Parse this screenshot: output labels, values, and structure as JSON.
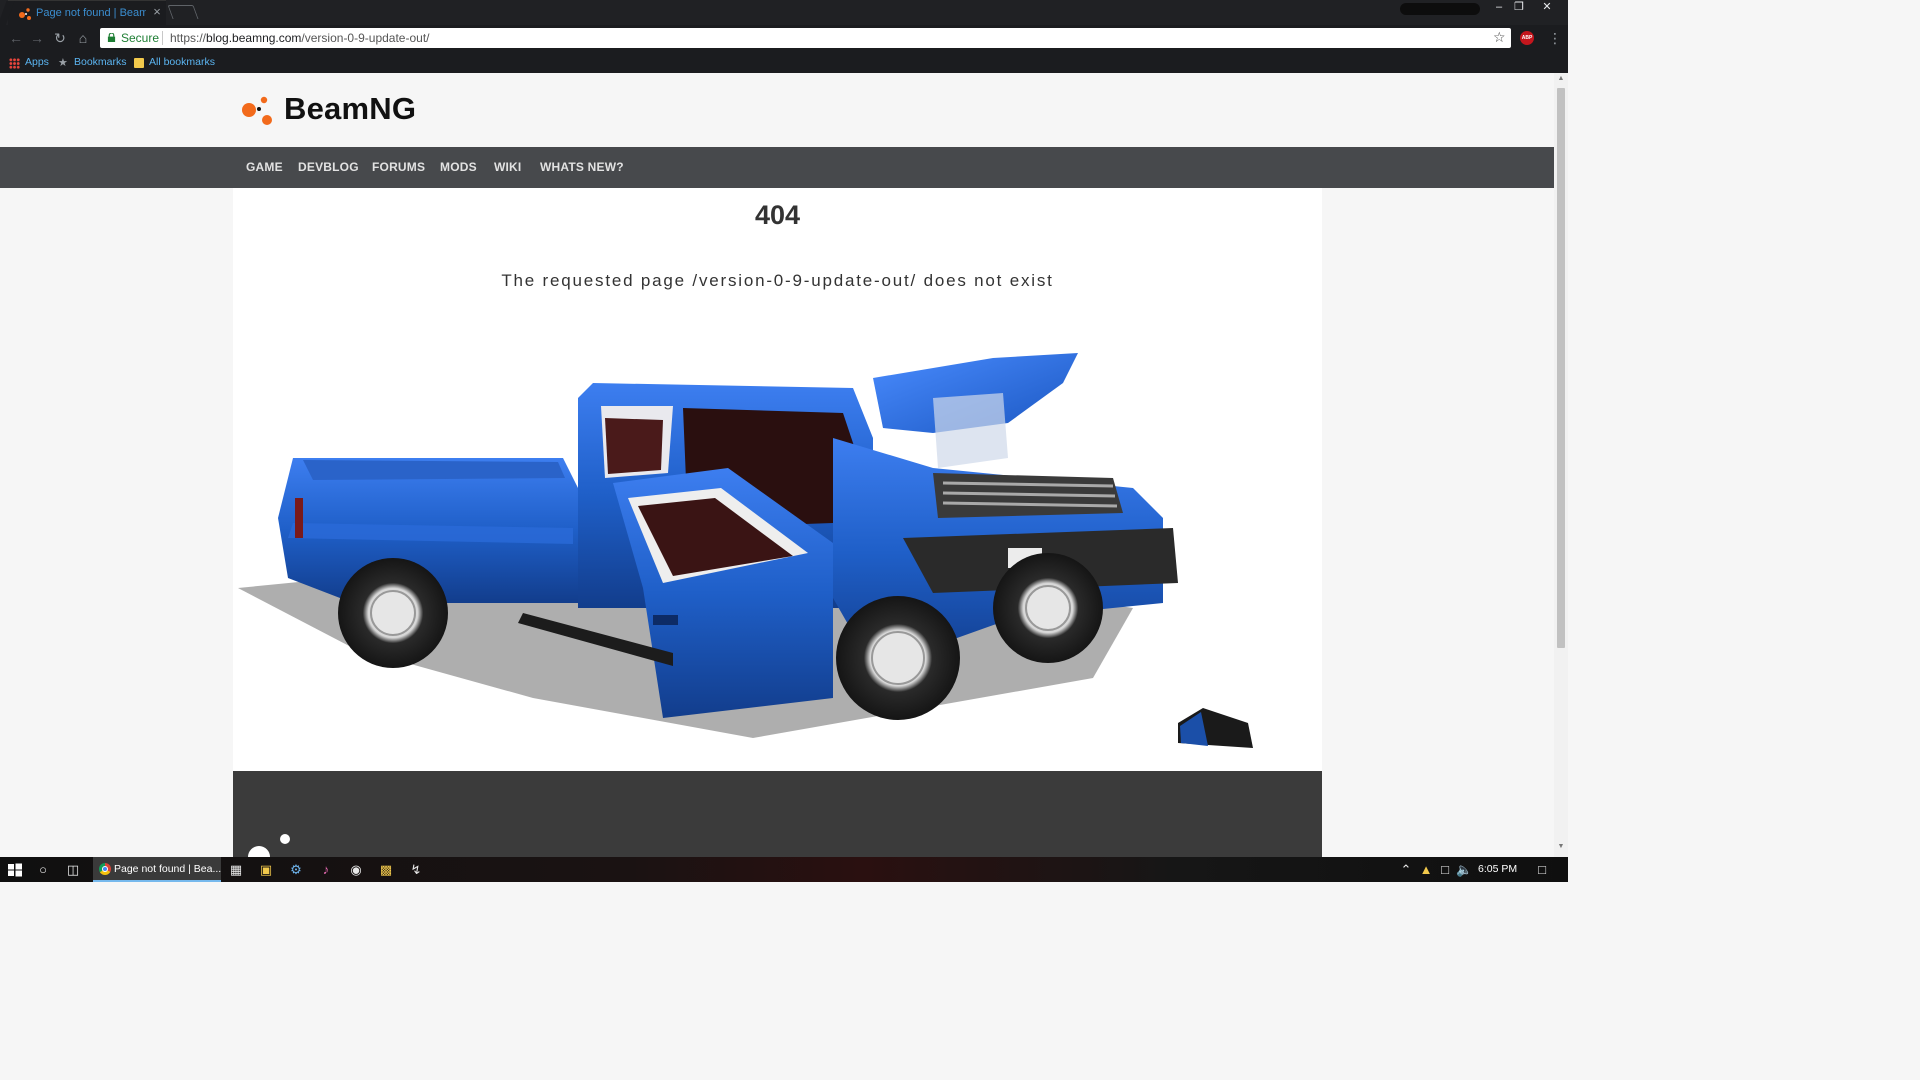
{
  "browser": {
    "tab_title": "Page not found | BeamN",
    "tab_close": "×",
    "secure_label": "Secure",
    "url_scheme": "https://",
    "url_host": "blog.beamng.com",
    "url_path": "/version-0-9-update-out/",
    "window_minimize": "–",
    "window_restore": "❐",
    "window_close": "✕"
  },
  "bookmarks": {
    "apps": "Apps",
    "bookmarks": "Bookmarks",
    "all_bookmarks": "All bookmarks"
  },
  "site": {
    "logo_text": "BeamNG",
    "nav": [
      "GAME",
      "DEVBLOG",
      "FORUMS",
      "MODS",
      "WIKI",
      "WHATS NEW?"
    ]
  },
  "error": {
    "code": "404",
    "message": "The requested page /version-0-9-update-out/ does not exist"
  },
  "taskbar": {
    "chrome_label": "Page not found | Bea...",
    "clock": "6:05 PM"
  },
  "icons": {
    "back": "arrow-left-icon",
    "forward": "arrow-right-icon",
    "reload": "reload-icon",
    "home": "home-icon",
    "lock": "lock-icon",
    "star": "star-icon",
    "abp": "adblock-icon",
    "menu": "kebab-menu-icon"
  },
  "colors": {
    "brand_orange": "#f26a1b",
    "nav_bar": "#47494c",
    "truck_blue": "#1f5fc8"
  }
}
